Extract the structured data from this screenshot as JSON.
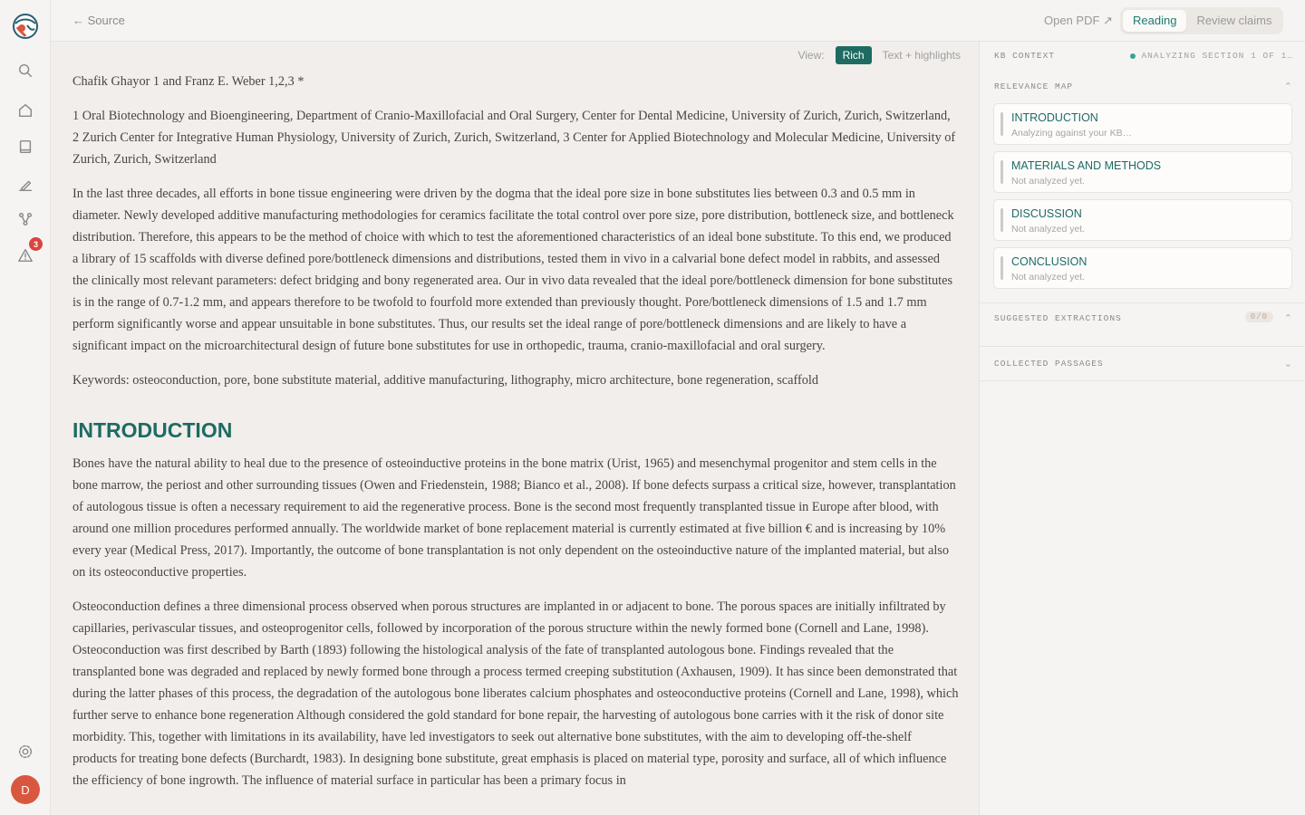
{
  "nav": {
    "back_label": "← Source",
    "open_pdf_label": "Open PDF ↗",
    "modes": [
      "Reading",
      "Review claims"
    ],
    "alert_count": "3",
    "avatar_initial": "D"
  },
  "doc": {
    "view_label": "View:",
    "view_rich": "Rich",
    "view_highlights": "Text + highlights",
    "authors": "Chafik Ghayor 1 and Franz E. Weber 1,2,3 *",
    "affiliations": "1 Oral Biotechnology and Bioengineering, Department of Cranio-Maxillofacial and Oral Surgery, Center for Dental Medicine, University of Zurich, Zurich, Switzerland, 2 Zurich Center for Integrative Human Physiology, University of Zurich, Zurich, Switzerland, 3 Center for Applied Biotechnology and Molecular Medicine, University of Zurich, Zurich, Switzerland",
    "abstract": "In the last three decades, all efforts in bone tissue engineering were driven by the dogma that the ideal pore size in bone substitutes lies between 0.3 and 0.5 mm in diameter. Newly developed additive manufacturing methodologies for ceramics facilitate the total control over pore size, pore distribution, bottleneck size, and bottleneck distribution. Therefore, this appears to be the method of choice with which to test the aforementioned characteristics of an ideal bone substitute. To this end, we produced a library of 15 scaffolds with diverse defined pore/bottleneck dimensions and distributions, tested them in vivo in a calvarial bone defect model in rabbits, and assessed the clinically most relevant parameters: defect bridging and bony regenerated area. Our in vivo data revealed that the ideal pore/bottleneck dimension for bone substitutes is in the range of 0.7-1.2 mm, and appears therefore to be twofold to fourfold more extended than previously thought. Pore/bottleneck dimensions of 1.5 and 1.7 mm perform significantly worse and appear unsuitable in bone substitutes. Thus, our results set the ideal range of pore/bottleneck dimensions and are likely to have a significant impact on the microarchitectural design of future bone substitutes for use in orthopedic, trauma, cranio-maxillofacial and oral surgery.",
    "keywords": "Keywords: osteoconduction, pore, bone substitute material, additive manufacturing, lithography, micro architecture, bone regeneration, scaffold",
    "intro_heading": "INTRODUCTION",
    "intro_p1": "Bones have the natural ability to heal due to the presence of osteoinductive proteins in the bone matrix (Urist, 1965) and mesenchymal progenitor and stem cells in the bone marrow, the periost and other surrounding tissues (Owen and Friedenstein, 1988; Bianco et al., 2008). If bone defects surpass a critical size, however, transplantation of autologous tissue is often a necessary requirement to aid the regenerative process. Bone is the second most frequently transplanted tissue in Europe after blood, with around one million procedures performed annually. The worldwide market of bone replacement material is currently estimated at five billion € and is increasing by 10% every year (Medical Press, 2017). Importantly, the outcome of bone transplantation is not only dependent on the osteoinductive nature of the implanted material, but also on its osteoconductive properties.",
    "intro_p2": "Osteoconduction defines a three dimensional process observed when porous structures are implanted in or adjacent to bone. The porous spaces are initially infiltrated by capillaries, perivascular tissues, and osteoprogenitor cells, followed by incorporation of the porous structure within the newly formed bone (Cornell and Lane, 1998). Osteoconduction was first described by Barth (1893) following the histological analysis of the fate of transplanted autologous bone. Findings revealed that the transplanted bone was degraded and replaced by newly formed bone through a process termed creeping substitution (Axhausen, 1909). It has since been demonstrated that during the latter phases of this process, the degradation of the autologous bone liberates calcium phosphates and osteoconductive proteins (Cornell and Lane, 1998), which further serve to enhance bone regeneration Although considered the gold standard for bone repair, the harvesting of autologous bone carries with it the risk of donor site morbidity. This, together with limitations in its availability, have led investigators to seek out alternative bone substitutes, with the aim to developing off-the-shelf products for treating bone defects (Burchardt, 1983). In designing bone substitute, great emphasis is placed on material type, porosity and surface, all of which influence the efficiency of bone ingrowth. The influence of material surface in particular has been a primary focus in"
  },
  "panel": {
    "kb_context": "KB CONTEXT",
    "status": "ANALYZING SECTION 1 OF 1…",
    "relevance_map": "RELEVANCE MAP",
    "cards": [
      {
        "title": "INTRODUCTION",
        "sub": "Analyzing against your KB…"
      },
      {
        "title": "MATERIALS AND METHODS",
        "sub": "Not analyzed yet."
      },
      {
        "title": "DISCUSSION",
        "sub": "Not analyzed yet."
      },
      {
        "title": "CONCLUSION",
        "sub": "Not analyzed yet."
      }
    ],
    "suggested_extractions": "SUGGESTED EXTRACTIONS",
    "suggested_count": "0/0",
    "collected_passages": "COLLECTED PASSAGES"
  }
}
